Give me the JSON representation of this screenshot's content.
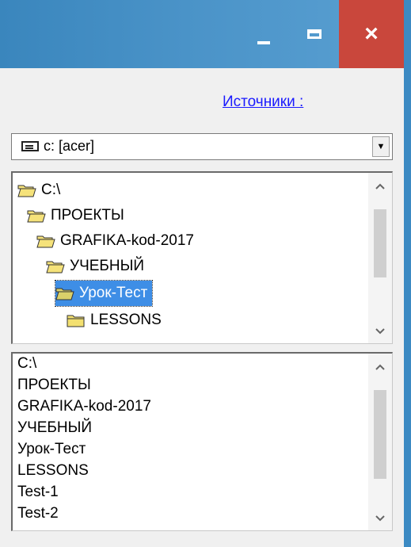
{
  "titlebar": {
    "minimize_icon": "minimize-icon",
    "maximize_icon": "maximize-icon",
    "close_label": "×"
  },
  "sources_link": "Источники :",
  "drive_select": {
    "icon": "drive-icon",
    "value": "c: [acer]",
    "arrow": "▼"
  },
  "folder_tree": {
    "items": [
      {
        "label": "C:\\",
        "icon": "open-folder-icon"
      },
      {
        "label": "ПРОЕКТЫ",
        "icon": "open-folder-icon"
      },
      {
        "label": "GRAFIKA-kod-2017",
        "icon": "open-folder-icon"
      },
      {
        "label": "УЧЕБНЫЙ",
        "icon": "open-folder-icon"
      },
      {
        "label": "Урок-Тест",
        "icon": "open-folder-icon",
        "selected": true
      },
      {
        "label": "LESSONS",
        "icon": "closed-folder-icon"
      }
    ],
    "scroll_up": "^",
    "scroll_down": "v"
  },
  "path_list": {
    "items": [
      "C:\\",
      "ПРОЕКТЫ",
      "GRAFIKA-kod-2017",
      "УЧЕБНЫЙ",
      "Урок-Тест",
      "LESSONS",
      "Test-1",
      "Test-2"
    ],
    "scroll_up": "^",
    "scroll_down": "v"
  },
  "colors": {
    "titlebar": "#4a93c8",
    "close_button": "#c9473c",
    "selection": "#3e8ee6",
    "link": "#1a1aff"
  }
}
